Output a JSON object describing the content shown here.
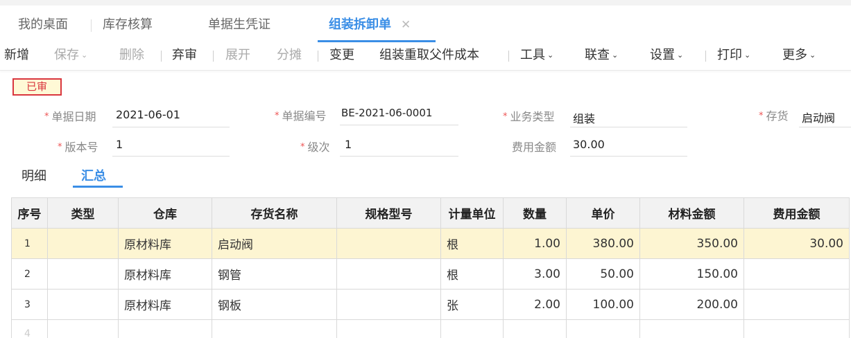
{
  "tabs": [
    {
      "label": "我的桌面"
    },
    {
      "label": "库存核算"
    },
    {
      "label": "单据生凭证"
    },
    {
      "label": "组装拆卸单",
      "close": "✕"
    }
  ],
  "toolbar": {
    "add": "新增",
    "save": "保存",
    "delete": "删除",
    "abandon_audit": "弃审",
    "expand": "展开",
    "allocate": "分摊",
    "change": "变更",
    "refetch_cost": "组装重取父件成本",
    "tools": "工具",
    "query": "联查",
    "settings": "设置",
    "print": "打印",
    "more": "更多",
    "chevron": "⌄"
  },
  "status": "已审",
  "form": {
    "doc_date": {
      "label": "单据日期",
      "value": "2021-06-01"
    },
    "doc_no": {
      "label": "单据编号",
      "value": "BE-2021-06-0001"
    },
    "biz_type": {
      "label": "业务类型",
      "value": "组装"
    },
    "inventory": {
      "label": "存货",
      "value": "启动阀"
    },
    "version": {
      "label": "版本号",
      "value": "1"
    },
    "level": {
      "label": "级次",
      "value": "1"
    },
    "expense": {
      "label": "费用金额",
      "value": "30.00"
    },
    "required_mark": "*"
  },
  "subtabs": [
    {
      "label": "明细"
    },
    {
      "label": "汇总"
    }
  ],
  "table": {
    "headers": [
      "序号",
      "类型",
      "仓库",
      "存货名称",
      "规格型号",
      "计量单位",
      "数量",
      "单价",
      "材料金额",
      "费用金额"
    ],
    "rows": [
      {
        "seq": "1",
        "type": "",
        "warehouse": "原材料库",
        "name": "启动阀",
        "spec": "",
        "unit": "根",
        "qty": "1.00",
        "price": "380.00",
        "material": "350.00",
        "expense": "30.00"
      },
      {
        "seq": "2",
        "type": "",
        "warehouse": "原材料库",
        "name": "钢管",
        "spec": "",
        "unit": "根",
        "qty": "3.00",
        "price": "50.00",
        "material": "150.00",
        "expense": ""
      },
      {
        "seq": "3",
        "type": "",
        "warehouse": "原材料库",
        "name": "钢板",
        "spec": "",
        "unit": "张",
        "qty": "2.00",
        "price": "100.00",
        "material": "200.00",
        "expense": ""
      },
      {
        "seq": "4"
      }
    ]
  }
}
